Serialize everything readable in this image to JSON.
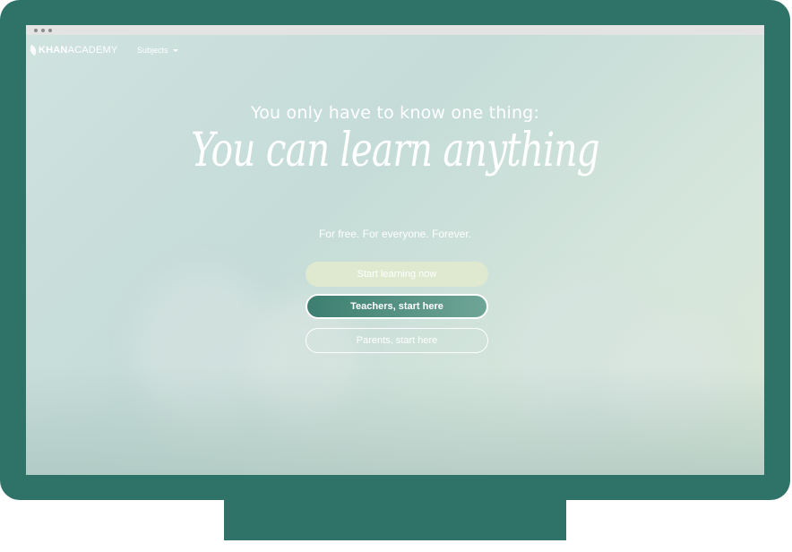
{
  "nav": {
    "logo_bold": "KHAN",
    "logo_light": "ACADEMY",
    "subjects_label": "Subjects"
  },
  "hero": {
    "headline_small": "You only have to know one thing:",
    "headline_big": "You can learn anything",
    "tagline": "For free. For everyone. Forever."
  },
  "buttons": {
    "start_learning": "Start learning now",
    "teachers": "Teachers, start here",
    "parents": "Parents, start here"
  },
  "colors": {
    "frame": "#2f7268",
    "teachers_button": "#3c7f70"
  },
  "icons": [
    "leaf-icon",
    "chevron-down-icon"
  ]
}
